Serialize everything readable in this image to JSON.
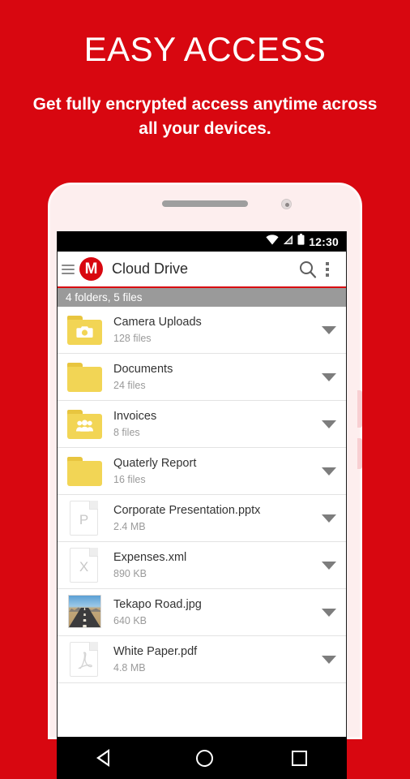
{
  "promo": {
    "title": "EASY ACCESS",
    "subtitle": "Get fully encrypted access anytime across all your devices."
  },
  "colors": {
    "background_red": "#d80710",
    "folder_yellow": "#f2d555",
    "subheader_gray": "#9a9a9a",
    "accent": "#d80710"
  },
  "statusbar": {
    "wifi_icon": "wifi-icon",
    "signal_icon": "signal-icon",
    "battery_icon": "battery-icon",
    "time": "12:30"
  },
  "appbar": {
    "menu_icon": "hamburger-menu-icon",
    "logo": "M",
    "title": "Cloud Drive",
    "search_icon": "search-icon",
    "overflow_icon": "overflow-menu-icon"
  },
  "subheader": {
    "text": "4 folders, 5 files"
  },
  "list": [
    {
      "name": "Camera Uploads",
      "meta": "128 files",
      "icon": "folder-camera-icon",
      "type": "folder"
    },
    {
      "name": "Documents",
      "meta": "24 files",
      "icon": "folder-icon",
      "type": "folder"
    },
    {
      "name": "Invoices",
      "meta": "8 files",
      "icon": "folder-shared-icon",
      "type": "folder"
    },
    {
      "name": "Quaterly Report",
      "meta": "16 files",
      "icon": "folder-icon",
      "type": "folder"
    },
    {
      "name": "Corporate Presentation.pptx",
      "meta": "2.4 MB",
      "icon": "file-powerpoint-icon",
      "type": "doc",
      "letter": "P"
    },
    {
      "name": "Expenses.xml",
      "meta": "890 KB",
      "icon": "file-excel-icon",
      "type": "doc",
      "letter": "X"
    },
    {
      "name": "Tekapo Road.jpg",
      "meta": "640 KB",
      "icon": "image-thumbnail",
      "type": "photo"
    },
    {
      "name": "White Paper.pdf",
      "meta": "4.8 MB",
      "icon": "file-pdf-icon",
      "type": "pdf"
    }
  ],
  "row_action_icon": "expand-caret-icon",
  "navbar": {
    "back_icon": "android-back-icon",
    "home_icon": "android-home-icon",
    "recents_icon": "android-recents-icon"
  }
}
